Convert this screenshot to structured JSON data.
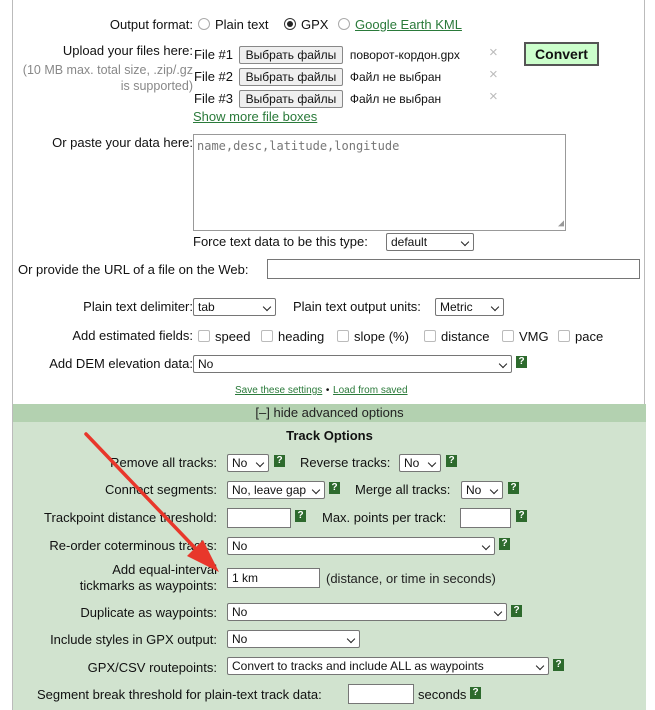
{
  "output_format": {
    "label": "Output format:",
    "options": [
      "Plain text",
      "GPX",
      "Google Earth KML"
    ],
    "selected": "GPX"
  },
  "upload": {
    "label": "Upload your files here:",
    "hint": "(10 MB max. total size, .zip/.gz is supported)",
    "files": [
      {
        "label": "File #1",
        "button": "Выбрать файлы",
        "filename": "поворот-кордон.gpx"
      },
      {
        "label": "File #2",
        "button": "Выбрать файлы",
        "filename": "Файл не выбран"
      },
      {
        "label": "File #3",
        "button": "Выбрать файлы",
        "filename": "Файл не выбран"
      }
    ],
    "show_more": "Show more file boxes",
    "convert": "Convert"
  },
  "paste": {
    "label": "Or paste your data here:",
    "placeholder": "name,desc,latitude,longitude",
    "force_label": "Force text data to be this type:",
    "force_value": "default"
  },
  "url": {
    "label": "Or provide the URL of a file on the Web:",
    "value": ""
  },
  "delimiter": {
    "label": "Plain text delimiter:",
    "value": "tab"
  },
  "units": {
    "label": "Plain text output units:",
    "value": "Metric"
  },
  "estimated": {
    "label": "Add estimated fields:",
    "fields": [
      "speed",
      "heading",
      "slope (%)",
      "distance",
      "VMG",
      "pace"
    ]
  },
  "dem": {
    "label": "Add DEM elevation data:",
    "value": "No"
  },
  "settings": {
    "save": "Save these settings",
    "sep": "•",
    "load": "Load from saved"
  },
  "advanced": {
    "toggle": "[–] hide advanced options",
    "section_title": "Track Options"
  },
  "track": {
    "remove_all": {
      "label": "Remove all tracks:",
      "value": "No"
    },
    "reverse": {
      "label": "Reverse tracks:",
      "value": "No"
    },
    "connect": {
      "label": "Connect segments:",
      "value": "No, leave gap"
    },
    "merge_all": {
      "label": "Merge all tracks:",
      "value": "No"
    },
    "distance_threshold": {
      "label": "Trackpoint distance threshold:",
      "value": ""
    },
    "max_points": {
      "label": "Max. points per track:",
      "value": ""
    },
    "reorder": {
      "label": "Re-order coterminous tracks:",
      "value": "No"
    },
    "tickmarks": {
      "label_line1": "Add equal-interval",
      "label_line2": "tickmarks as waypoints:",
      "value": "1 km",
      "hint": "(distance, or time in seconds)"
    },
    "duplicate": {
      "label": "Duplicate as waypoints:",
      "value": "No"
    },
    "styles": {
      "label": "Include styles in GPX output:",
      "value": "No"
    },
    "routepoints": {
      "label": "GPX/CSV routepoints:",
      "value": "Convert to tracks and include ALL as waypoints"
    },
    "segment_break": {
      "label": "Segment break threshold for plain-text track data:",
      "value": "",
      "unit": "seconds"
    }
  },
  "help_glyph": "?",
  "close_glyph": "×",
  "colors": {
    "arrow": "#e8372b",
    "advanced_bg": "#d1e3cf",
    "convert_bg": "#ccffcc",
    "link": "#2a7a3a"
  }
}
